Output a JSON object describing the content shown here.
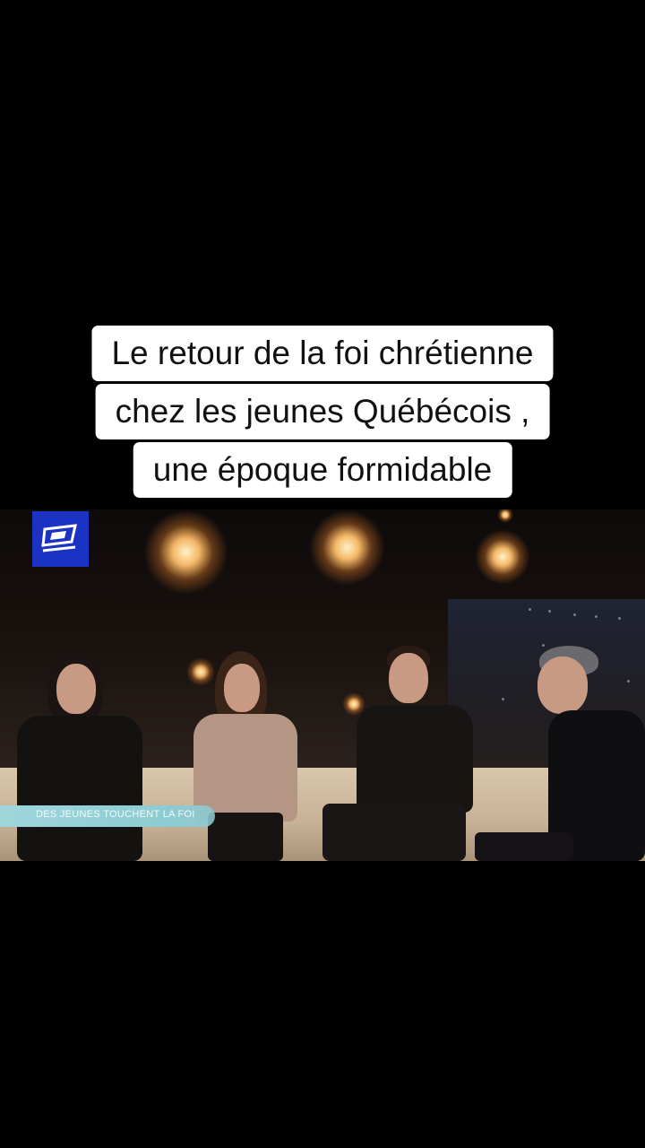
{
  "caption": {
    "line1": "Le retour de la foi chrétienne",
    "line2": "chez les jeunes Québécois ,",
    "line3": "une époque formidable"
  },
  "video": {
    "logo_icon": "broadcaster-logo-icon",
    "lower_third": "DES JEUNES TOUCHENT LA FOI",
    "colors": {
      "logo_bg": "#1b33c2",
      "lower_third_bg": "#9fd6dc",
      "caption_bg": "#ffffff"
    }
  }
}
